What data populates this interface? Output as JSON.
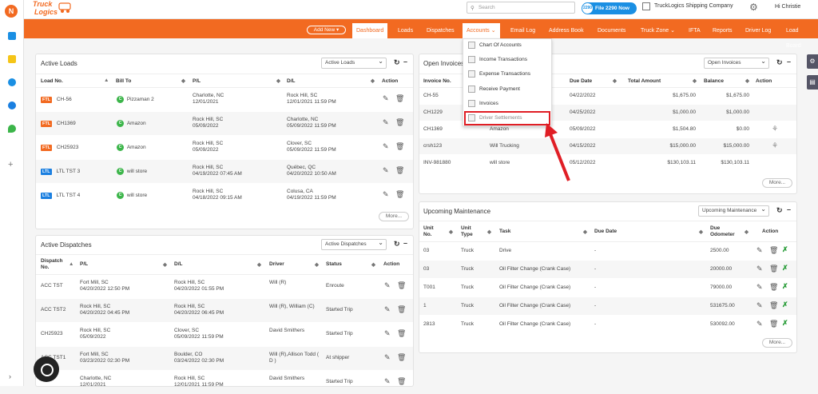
{
  "app": {
    "logo": "Truck Logics",
    "avatar": "N",
    "search_placeholder": "Search",
    "file_btn": "File 2290 Now",
    "file_badge": "2290",
    "company": "TruckLogics Shipping Company",
    "greeting": "Hi Christie"
  },
  "nav": {
    "add_new": "Add New",
    "items": [
      "Dashboard",
      "Loads",
      "Dispatches",
      "Accounts",
      "Email Log",
      "Address Book",
      "Documents",
      "Truck Zone",
      "IFTA",
      "Reports",
      "Driver Log",
      "Load Board"
    ],
    "active": "Dashboard"
  },
  "accounts_menu": [
    "Chart Of Accounts",
    "Income Transactions",
    "Expense Transactions",
    "Receive Payment",
    "Invoices",
    "Driver Settlements"
  ],
  "active_loads": {
    "title": "Active Loads",
    "select": "Active Loads",
    "more": "More...",
    "headers": [
      "Load No.",
      "Bill To",
      "P/L",
      "D/L",
      "Action"
    ],
    "rows": [
      {
        "type": "FTL",
        "no": "CH-56",
        "bill": "Pizzaman 2",
        "pl1": "Charlotte, NC",
        "pl2": "12/01/2021",
        "dl1": "Rock Hill, SC",
        "dl2": "12/01/2021 11:59 PM"
      },
      {
        "type": "FTL",
        "no": "CH1369",
        "bill": "Amazon",
        "pl1": "Rock Hill, SC",
        "pl2": "05/09/2022",
        "dl1": "Charlotte, NC",
        "dl2": "05/09/2022 11:59 PM"
      },
      {
        "type": "FTL",
        "no": "CH25923",
        "bill": "Amazon",
        "pl1": "Rock Hill, SC",
        "pl2": "05/09/2022",
        "dl1": "Clover, SC",
        "dl2": "05/09/2022 11:59 PM"
      },
      {
        "type": "LTL",
        "no": "LTL TST 3",
        "bill": "will store",
        "pl1": "Rock Hill, SC",
        "pl2": "04/19/2022 07:45 AM",
        "dl1": "Québec, QC",
        "dl2": "04/20/2022 10:50 AM"
      },
      {
        "type": "LTL",
        "no": "LTL TST 4",
        "bill": "will store",
        "pl1": "Rock Hill, SC",
        "pl2": "04/18/2022 09:15 AM",
        "dl1": "Colusa, CA",
        "dl2": "04/19/2022 11:59 PM"
      }
    ]
  },
  "active_dispatches": {
    "title": "Active Dispatches",
    "select": "Active Dispatches",
    "headers": [
      "Dispatch No.",
      "P/L",
      "D/L",
      "Driver",
      "Status",
      "Action"
    ],
    "rows": [
      {
        "no": "ACC TST",
        "pl1": "Fort Mill, SC",
        "pl2": "04/20/2022 12:50 PM",
        "dl1": "Rock Hill, SC",
        "dl2": "04/20/2022 01:55 PM",
        "driver": "Will (R)",
        "status": "Enroute"
      },
      {
        "no": "ACC TST2",
        "pl1": "Rock Hill, SC",
        "pl2": "04/20/2022 04:45 PM",
        "dl1": "Rock Hill, SC",
        "dl2": "04/20/2022 06:45 PM",
        "driver": "Will (R), William (C)",
        "status": "Started Trip"
      },
      {
        "no": "CH25923",
        "pl1": "Rock Hill, SC",
        "pl2": "05/09/2022",
        "dl1": "Clover, SC",
        "dl2": "05/09/2022 11:59 PM",
        "driver": "David Smithers",
        "status": "Started Trip"
      },
      {
        "no": "ACC TST1",
        "pl1": "Fort Mill, SC",
        "pl2": "03/23/2022 02:30 PM",
        "dl1": "Boulder, CO",
        "dl2": "03/24/2022 02:30 PM",
        "driver": "Will (R),Allison Todd ( D )",
        "status": "At shipper"
      },
      {
        "no": "",
        "pl1": "Charlotte, NC",
        "pl2": "12/01/2021",
        "dl1": "Rock Hill, SC",
        "dl2": "12/01/2021 11:59 PM",
        "driver": "David Smithers",
        "status": "Started Trip"
      }
    ]
  },
  "open_invoices": {
    "title": "Open Invoices",
    "select": "Open Invoices",
    "more": "More...",
    "headers": [
      "Invoice No.",
      "Due Date",
      "Total Amount",
      "Balance",
      "Action"
    ],
    "rows": [
      {
        "no": "CH-55",
        "customer": "",
        "due": "04/22/2022",
        "total": "$1,675.00",
        "bal": "$1,675.00"
      },
      {
        "no": "CH1229",
        "customer": "",
        "due": "04/25/2022",
        "total": "$1,000.00",
        "bal": "$1,000.00"
      },
      {
        "no": "CH1369",
        "customer": "Amazon",
        "due": "05/09/2022",
        "total": "$1,504.80",
        "bal": "$0.00"
      },
      {
        "no": "crsh123",
        "customer": "Will Trucking",
        "due": "04/15/2022",
        "total": "$15,000.00",
        "bal": "$15,000.00"
      },
      {
        "no": "INV-981880",
        "customer": "will store",
        "due": "05/12/2022",
        "total": "$130,103.11",
        "bal": "$130,103.11"
      }
    ]
  },
  "maintenance": {
    "title": "Upcoming Maintenance",
    "select": "Upcoming Maintenance",
    "more": "More...",
    "headers": [
      "Unit No.",
      "Unit Type",
      "Task",
      "Due Date",
      "Due Odometer",
      "Action"
    ],
    "rows": [
      {
        "unit": "03",
        "type": "Truck",
        "task": "Drive",
        "due": "-",
        "odo": "2500.00"
      },
      {
        "unit": "03",
        "type": "Truck",
        "task": "Oil Filter Change (Crank Case)",
        "due": "-",
        "odo": "20000.00"
      },
      {
        "unit": "T001",
        "type": "Truck",
        "task": "Oil Filter Change (Crank Case)",
        "due": "-",
        "odo": "79000.00"
      },
      {
        "unit": "1",
        "type": "Truck",
        "task": "Oil Filter Change (Crank Case)",
        "due": "-",
        "odo": "531675.00"
      },
      {
        "unit": "2813",
        "type": "Truck",
        "task": "Oil Filter Change (Crank Case)",
        "due": "-",
        "odo": "530092.00"
      }
    ]
  },
  "colors": {
    "brand": "#f26a21",
    "blue": "#1a8fe3",
    "highlight": "#e01e25"
  }
}
